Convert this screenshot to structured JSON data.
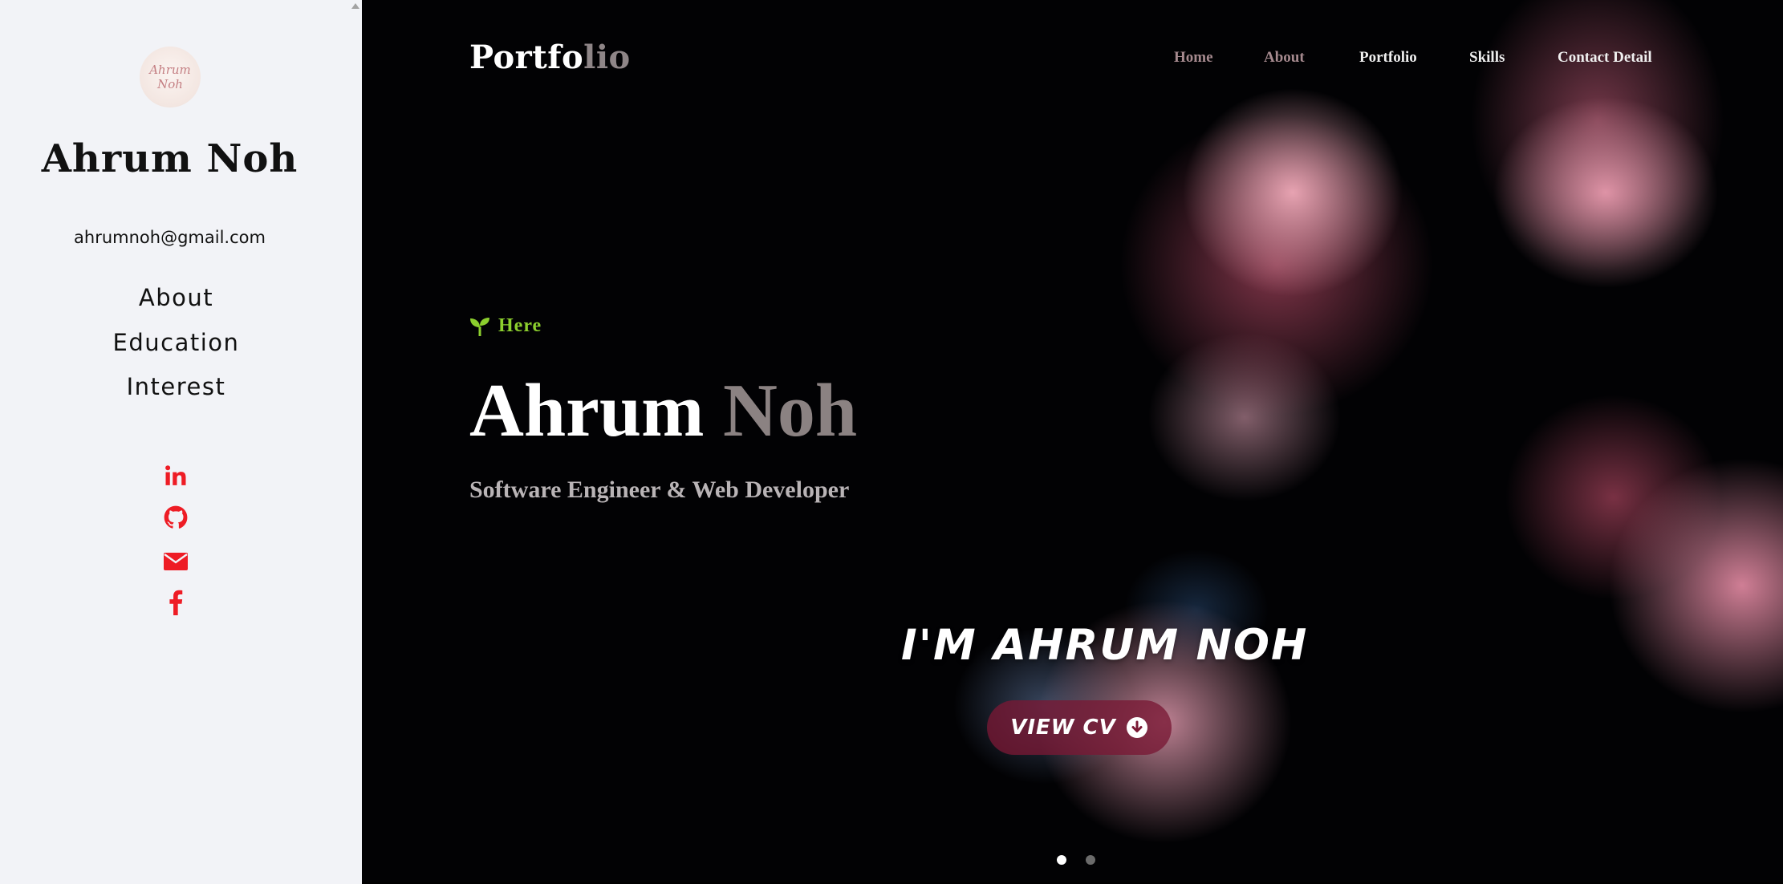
{
  "sidebar": {
    "avatar_text": "Ahrum Noh",
    "name": "Ahrum Noh",
    "email": "ahrumnoh@gmail.com",
    "nav": [
      {
        "label": "About"
      },
      {
        "label": "Education"
      },
      {
        "label": "Interest"
      }
    ],
    "social_icons": [
      "linkedin-icon",
      "github-icon",
      "email-icon",
      "facebook-icon"
    ],
    "accent_color": "#ee1c25"
  },
  "header": {
    "logo_part1": "Portfo",
    "logo_part2": "lio",
    "nav": [
      {
        "label": "Home"
      },
      {
        "label": "About"
      },
      {
        "label": "Portfolio"
      },
      {
        "label": "Skills"
      },
      {
        "label": "Contact Detail"
      }
    ]
  },
  "hero": {
    "tag": "Here",
    "tag_color": "#8ccf2e",
    "first_name": "Ahrum",
    "last_name": "Noh",
    "role": "Software Engineer & Web Developer",
    "intro": "I'M AHRUM NOH",
    "cta_label": "VIEW CV",
    "slides": 2,
    "active_slide": 1
  }
}
